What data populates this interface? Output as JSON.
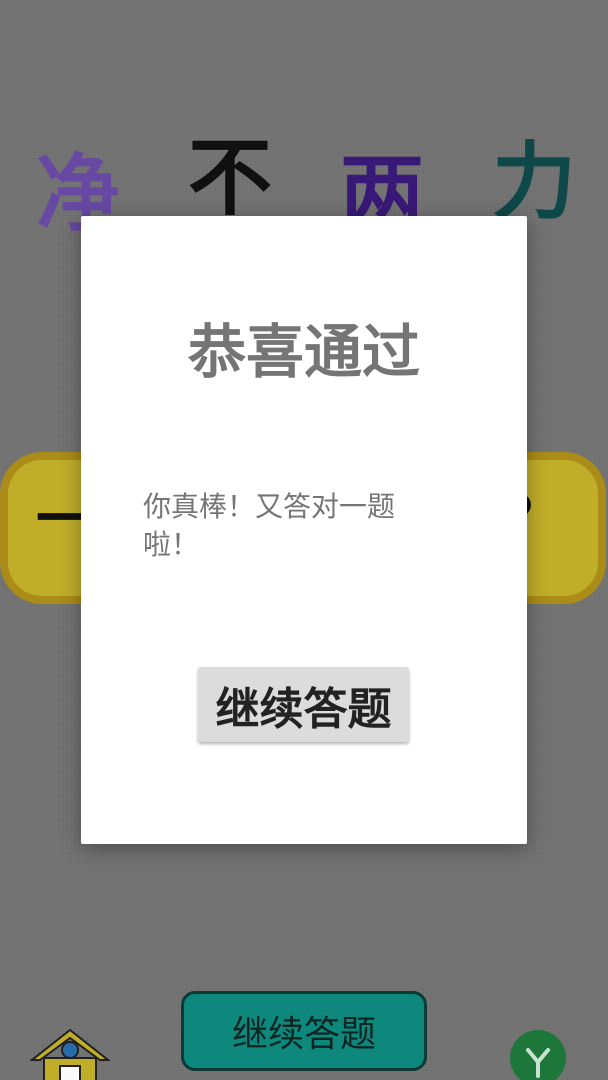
{
  "background": {
    "characters": [
      {
        "text": "净",
        "color": "#6a4aa6"
      },
      {
        "text": "不",
        "color": "#111111"
      },
      {
        "text": "两",
        "color": "#3b1a7a"
      },
      {
        "text": "力",
        "color": "#0f4a4a"
      }
    ],
    "answer_left": "一",
    "answer_right": "?",
    "answer_box_color": "#c4b22a",
    "continue_label": "继续答题",
    "continue_color": "#0f8a80",
    "home_icon": "home-icon",
    "share_icon": "share-icon"
  },
  "dialog": {
    "title": "恭喜通过",
    "message": "你真棒！又答对一题啦！",
    "button_label": "继续答题"
  }
}
